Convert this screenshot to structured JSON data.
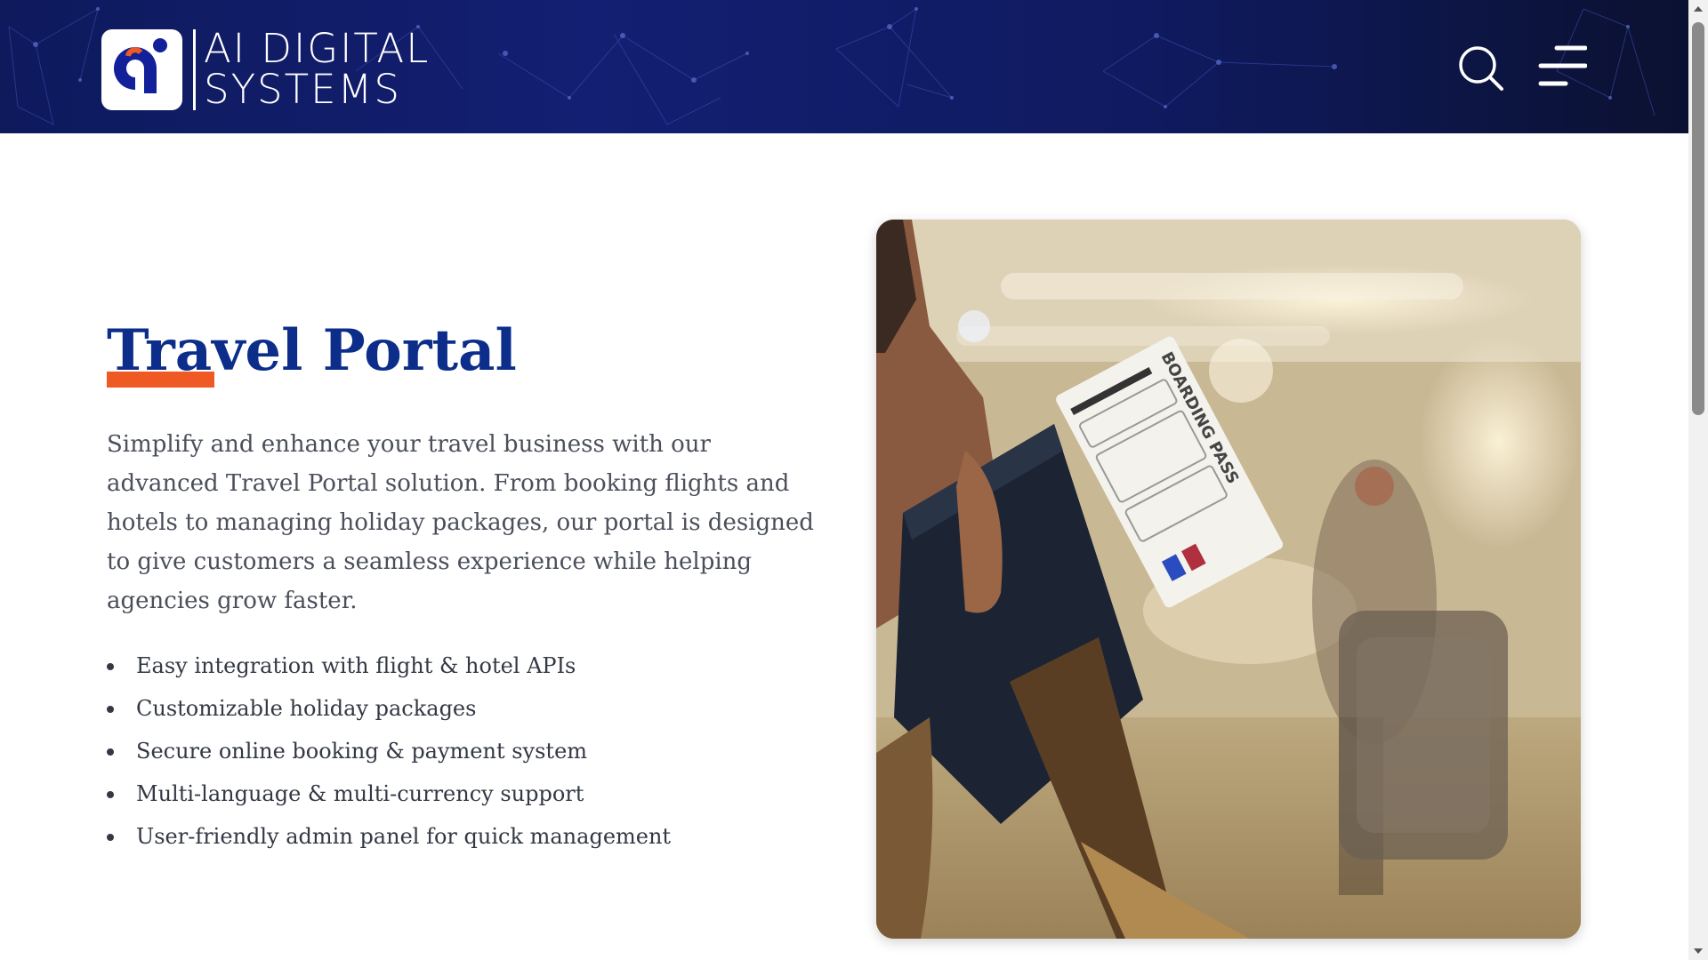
{
  "header": {
    "logo_line1": "AI DIGITAL",
    "logo_line2": "SYSTEMS",
    "search_icon": "search-icon",
    "menu_icon": "menu-icon"
  },
  "main": {
    "title": "Travel Portal",
    "description": "Simplify and enhance your travel business with our advanced Travel Portal solution. From booking flights and hotels to managing holiday packages, our portal is designed to give customers a seamless experience while helping agencies grow faster.",
    "features": [
      "Easy integration with flight & hotel APIs",
      "Customizable holiday packages",
      "Secure online booking & payment system",
      "Multi-language & multi-currency support",
      "User-friendly admin panel for quick management"
    ],
    "image_alt": "Traveler holding passport and boarding pass at airport",
    "boarding_pass_text": "BOARDING PASS"
  },
  "colors": {
    "header_bg": "#131f72",
    "title_color": "#0c2e8a",
    "accent": "#ef5a24",
    "body_text": "#4a4f5a"
  }
}
